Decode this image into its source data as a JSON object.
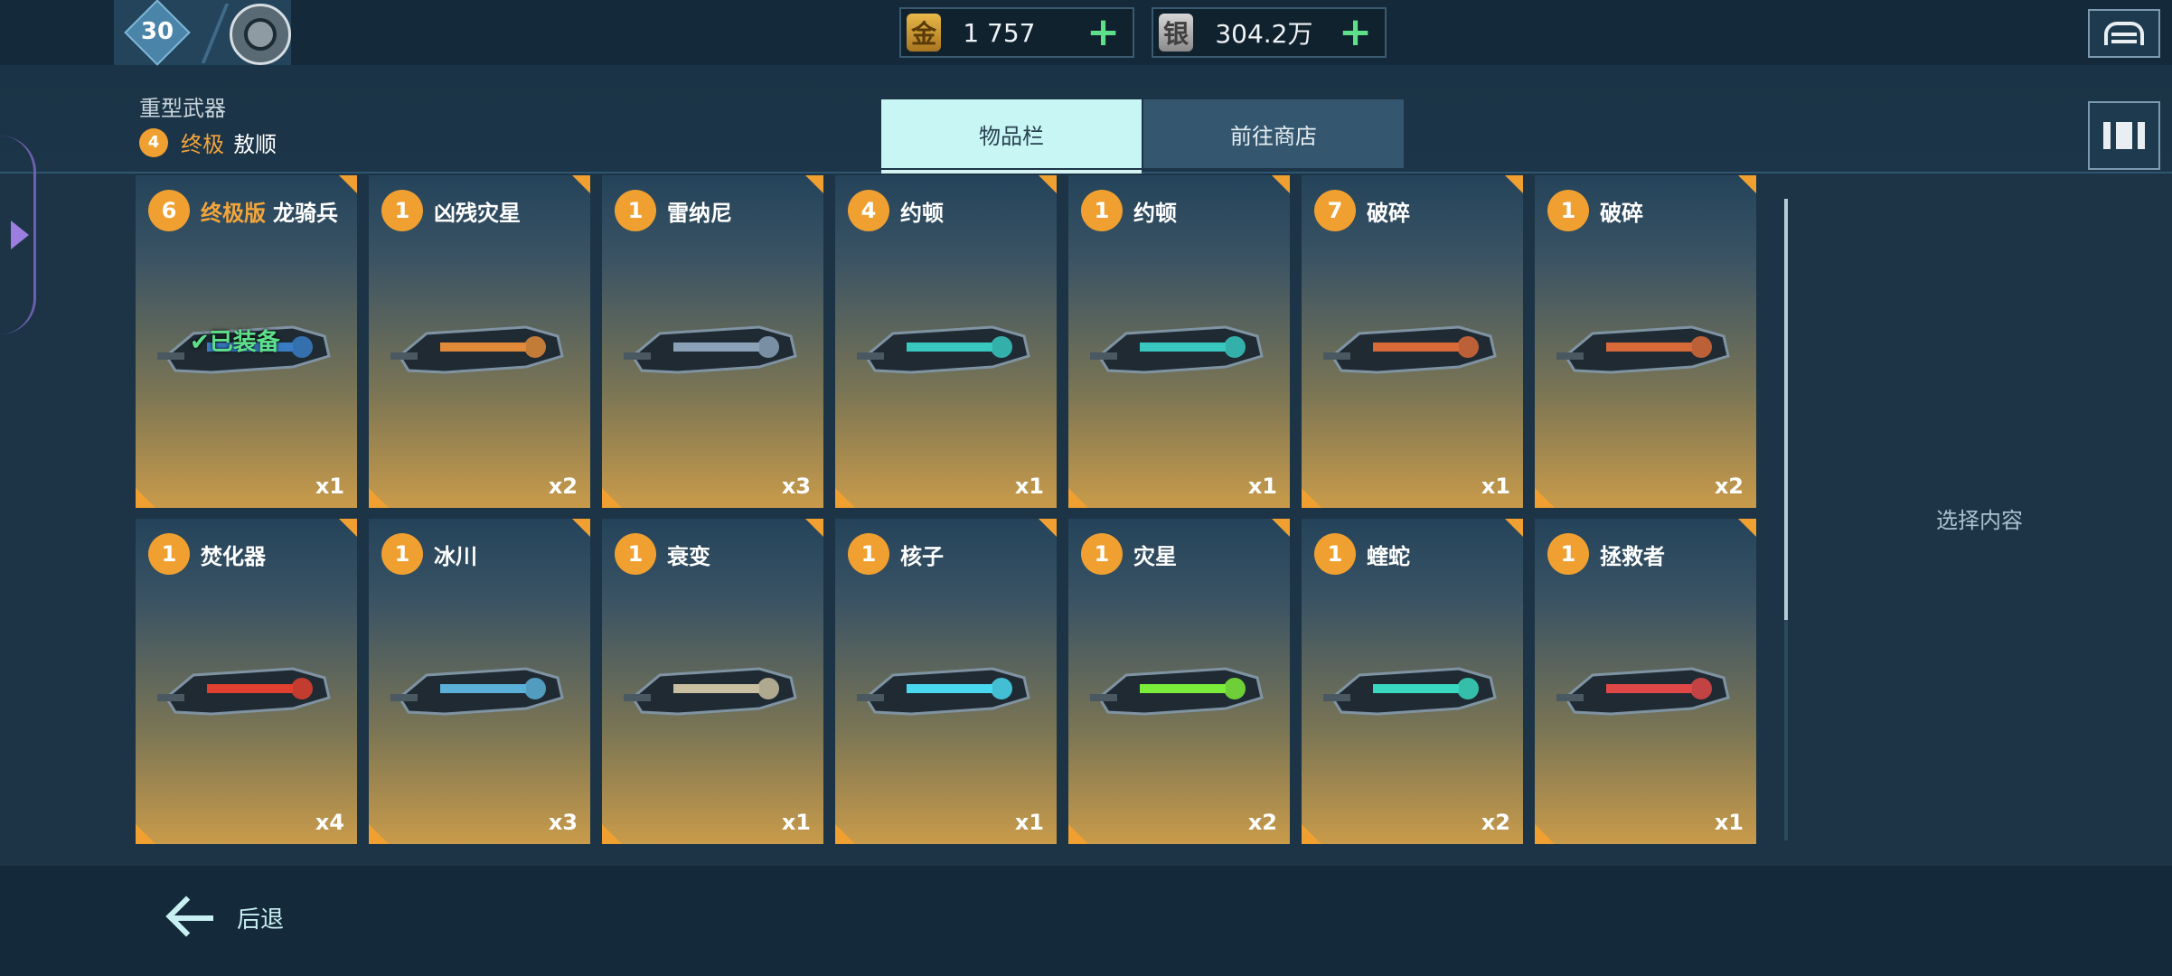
{
  "topbar": {
    "player_level": "30",
    "gold": {
      "icon_char": "金",
      "value": "1 757",
      "plus": "+"
    },
    "silver": {
      "icon_char": "银",
      "value": "304.2万",
      "plus": "+"
    }
  },
  "category": {
    "title": "重型武器",
    "filter_level": "4",
    "filter_tier": "终极",
    "filter_name": "敖顺"
  },
  "tabs": [
    {
      "label": "物品栏",
      "active": true
    },
    {
      "label": "前往商店",
      "active": false
    }
  ],
  "items": [
    {
      "level": "6",
      "prefix": "终极版",
      "name": "龙骑兵",
      "qty": "x1",
      "equipped_label": "✔已装备",
      "accent": "#3a7cc4"
    },
    {
      "level": "1",
      "prefix": "",
      "name": "凶残灾星",
      "qty": "x2",
      "accent": "#e08a3a"
    },
    {
      "level": "1",
      "prefix": "",
      "name": "雷纳尼",
      "qty": "x3",
      "accent": "#8aa2b8"
    },
    {
      "level": "4",
      "prefix": "",
      "name": "约顿",
      "qty": "x1",
      "accent": "#38c8c0"
    },
    {
      "level": "1",
      "prefix": "",
      "name": "约顿",
      "qty": "x1",
      "accent": "#38c8c0"
    },
    {
      "level": "7",
      "prefix": "",
      "name": "破碎",
      "qty": "x1",
      "accent": "#d86a3a"
    },
    {
      "level": "1",
      "prefix": "",
      "name": "破碎",
      "qty": "x2",
      "accent": "#d86a3a"
    },
    {
      "level": "1",
      "prefix": "",
      "name": "焚化器",
      "qty": "x4",
      "accent": "#e04030"
    },
    {
      "level": "1",
      "prefix": "",
      "name": "冰川",
      "qty": "x3",
      "accent": "#5ab0d8"
    },
    {
      "level": "1",
      "prefix": "",
      "name": "衰变",
      "qty": "x1",
      "accent": "#c8c0a0"
    },
    {
      "level": "1",
      "prefix": "",
      "name": "核子",
      "qty": "x1",
      "accent": "#4ad8f0"
    },
    {
      "level": "1",
      "prefix": "",
      "name": "灾星",
      "qty": "x2",
      "accent": "#7cec3a"
    },
    {
      "level": "1",
      "prefix": "",
      "name": "蝰蛇",
      "qty": "x2",
      "accent": "#3ad8c0"
    },
    {
      "level": "1",
      "prefix": "",
      "name": "拯救者",
      "qty": "x1",
      "accent": "#e04848"
    }
  ],
  "right_panel": {
    "placeholder": "选择内容"
  },
  "footer": {
    "back_label": "后退"
  }
}
